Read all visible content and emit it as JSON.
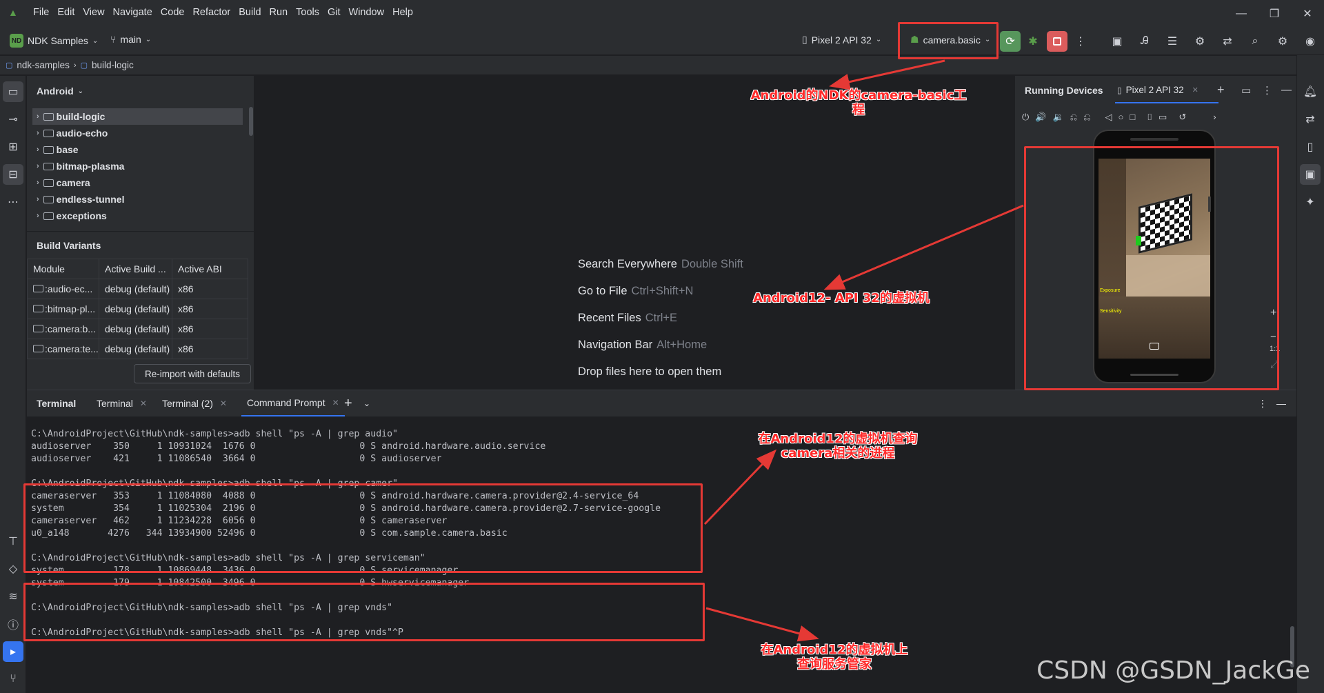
{
  "menu": [
    "File",
    "Edit",
    "View",
    "Navigate",
    "Code",
    "Refactor",
    "Build",
    "Run",
    "Tools",
    "Git",
    "Window",
    "Help"
  ],
  "toolbar": {
    "project_badge": "ND",
    "project_name": "NDK Samples",
    "branch": "main",
    "device": "Pixel 2 API 32",
    "run_config": "camera.basic"
  },
  "breadcrumb": [
    "ndk-samples",
    "build-logic"
  ],
  "project_panel": {
    "view_mode": "Android",
    "tree": [
      "build-logic",
      "audio-echo",
      "base",
      "bitmap-plasma",
      "camera",
      "endless-tunnel",
      "exceptions"
    ]
  },
  "build_variants": {
    "title": "Build Variants",
    "headers": [
      "Module",
      "Active Build ...",
      "Active ABI"
    ],
    "rows": [
      [
        ":audio-ec...",
        "debug (default)",
        "x86"
      ],
      [
        ":bitmap-pl...",
        "debug (default)",
        "x86"
      ],
      [
        ":camera:b...",
        "debug (default)",
        "x86"
      ],
      [
        ":camera:te...",
        "debug (default)",
        "x86"
      ]
    ],
    "reimport_label": "Re-import with defaults"
  },
  "editor_hints": [
    {
      "label": "Search Everywhere",
      "key": "Double Shift"
    },
    {
      "label": "Go to File",
      "key": "Ctrl+Shift+N"
    },
    {
      "label": "Recent Files",
      "key": "Ctrl+E"
    },
    {
      "label": "Navigation Bar",
      "key": "Alt+Home"
    },
    {
      "label": "Drop files here to open them",
      "key": ""
    }
  ],
  "running_devices": {
    "title": "Running Devices",
    "tab": "Pixel 2 API 32",
    "zoom_label": "1:1",
    "phone_labels": [
      "Exposure",
      "Sensitivity"
    ]
  },
  "terminal": {
    "tool_title": "Terminal",
    "tabs": [
      "Terminal",
      "Terminal (2)",
      "Command Prompt"
    ],
    "lines": [
      "C:\\AndroidProject\\GitHub\\ndk-samples>adb shell \"ps -A | grep audio\"",
      "audioserver    350     1 10931024  1676 0                   0 S android.hardware.audio.service",
      "audioserver    421     1 11086540  3664 0                   0 S audioserver",
      "",
      "C:\\AndroidProject\\GitHub\\ndk-samples>adb shell \"ps -A | grep camer\"",
      "cameraserver   353     1 11084080  4088 0                   0 S android.hardware.camera.provider@2.4-service_64",
      "system         354     1 11025304  2196 0                   0 S android.hardware.camera.provider@2.7-service-google",
      "cameraserver   462     1 11234228  6056 0                   0 S cameraserver",
      "u0_a148       4276   344 13934900 52496 0                   0 S com.sample.camera.basic",
      "",
      "C:\\AndroidProject\\GitHub\\ndk-samples>adb shell \"ps -A | grep serviceman\"",
      "system         178     1 10869448  3436 0                   0 S servicemanager",
      "system         179     1 10842500  3496 0                   0 S hwservicemanager",
      "",
      "C:\\AndroidProject\\GitHub\\ndk-samples>adb shell \"ps -A | grep vnds\"",
      "",
      "C:\\AndroidProject\\GitHub\\ndk-samples>adb shell \"ps -A | grep vnds\"^P"
    ]
  },
  "annotations": {
    "note_project": "Android的NDK的camera-basic工程",
    "note_emulator": "Android12- API 32的虚拟机",
    "note_camera_line1": "在Android12的虚拟机查询",
    "note_camera_line2": "camera相关的进程",
    "note_service_line1": "在Android12的虚拟机上",
    "note_service_line2": "查询服务管家",
    "color": "#e53935"
  },
  "watermark": "CSDN @GSDN_JackGe"
}
